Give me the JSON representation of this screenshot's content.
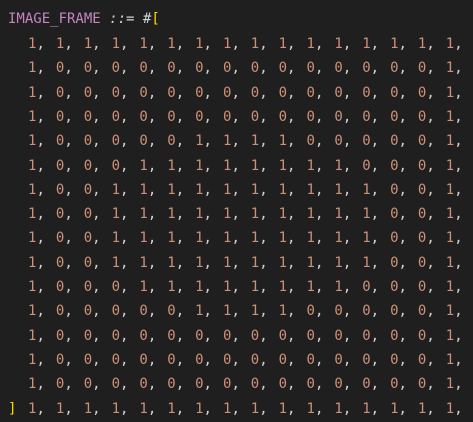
{
  "code": {
    "identifier": "IMAGE_FRAME",
    "operator": "::=",
    "hash": "#",
    "open_bracket": "[",
    "close_bracket": "]",
    "separator": ",",
    "rows": [
      [
        "1",
        "1",
        "1",
        "1",
        "1",
        "1",
        "1",
        "1",
        "1",
        "1",
        "1",
        "1",
        "1",
        "1",
        "1",
        "1"
      ],
      [
        "1",
        "0",
        "0",
        "0",
        "0",
        "0",
        "0",
        "0",
        "0",
        "0",
        "0",
        "0",
        "0",
        "0",
        "0",
        "1"
      ],
      [
        "1",
        "0",
        "0",
        "0",
        "0",
        "0",
        "0",
        "0",
        "0",
        "0",
        "0",
        "0",
        "0",
        "0",
        "0",
        "1"
      ],
      [
        "1",
        "0",
        "0",
        "0",
        "0",
        "0",
        "0",
        "0",
        "0",
        "0",
        "0",
        "0",
        "0",
        "0",
        "0",
        "1"
      ],
      [
        "1",
        "0",
        "0",
        "0",
        "0",
        "0",
        "1",
        "1",
        "1",
        "1",
        "0",
        "0",
        "0",
        "0",
        "0",
        "1"
      ],
      [
        "1",
        "0",
        "0",
        "0",
        "1",
        "1",
        "1",
        "1",
        "1",
        "1",
        "1",
        "1",
        "0",
        "0",
        "0",
        "1"
      ],
      [
        "1",
        "0",
        "0",
        "1",
        "1",
        "1",
        "1",
        "1",
        "1",
        "1",
        "1",
        "1",
        "1",
        "0",
        "0",
        "1"
      ],
      [
        "1",
        "0",
        "0",
        "1",
        "1",
        "1",
        "1",
        "1",
        "1",
        "1",
        "1",
        "1",
        "1",
        "0",
        "0",
        "1"
      ],
      [
        "1",
        "0",
        "0",
        "1",
        "1",
        "1",
        "1",
        "1",
        "1",
        "1",
        "1",
        "1",
        "1",
        "0",
        "0",
        "1"
      ],
      [
        "1",
        "0",
        "0",
        "1",
        "1",
        "1",
        "1",
        "1",
        "1",
        "1",
        "1",
        "1",
        "1",
        "0",
        "0",
        "1"
      ],
      [
        "1",
        "0",
        "0",
        "0",
        "1",
        "1",
        "1",
        "1",
        "1",
        "1",
        "1",
        "1",
        "0",
        "0",
        "0",
        "1"
      ],
      [
        "1",
        "0",
        "0",
        "0",
        "0",
        "0",
        "1",
        "1",
        "1",
        "1",
        "0",
        "0",
        "0",
        "0",
        "0",
        "1"
      ],
      [
        "1",
        "0",
        "0",
        "0",
        "0",
        "0",
        "0",
        "0",
        "0",
        "0",
        "0",
        "0",
        "0",
        "0",
        "0",
        "1"
      ],
      [
        "1",
        "0",
        "0",
        "0",
        "0",
        "0",
        "0",
        "0",
        "0",
        "0",
        "0",
        "0",
        "0",
        "0",
        "0",
        "1"
      ],
      [
        "1",
        "0",
        "0",
        "0",
        "0",
        "0",
        "0",
        "0",
        "0",
        "0",
        "0",
        "0",
        "0",
        "0",
        "0",
        "1"
      ],
      [
        "1",
        "1",
        "1",
        "1",
        "1",
        "1",
        "1",
        "1",
        "1",
        "1",
        "1",
        "1",
        "1",
        "1",
        "1",
        "1"
      ]
    ]
  },
  "colors": {
    "background": "#1f1f1f",
    "identifier": "#c586c0",
    "number": "#ce9178",
    "punctuation": "#d4d4d4",
    "bracket": "#ffd700"
  }
}
